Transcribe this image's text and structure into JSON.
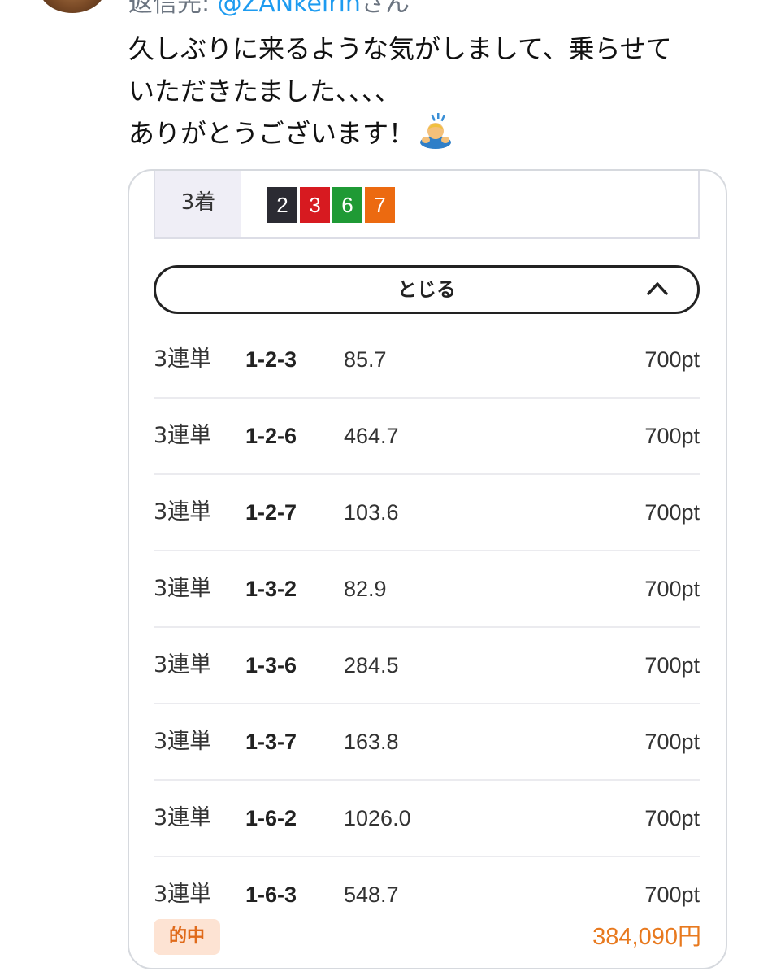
{
  "tweet": {
    "reply_prefix": "返信先: ",
    "reply_handle": "@ZANkeirin",
    "reply_suffix": "さん",
    "text_lines": [
      "久しぶりに来るような気がしまして、乗らせて",
      "いただきたました、、、、",
      "ありがとうございます！"
    ],
    "emoji": "man-bowing-emoji"
  },
  "card": {
    "place_label": "3着",
    "bike_numbers": [
      {
        "num": "2",
        "color": "#2b2b33"
      },
      {
        "num": "3",
        "color": "#d71a20"
      },
      {
        "num": "6",
        "color": "#1f9a35"
      },
      {
        "num": "7",
        "color": "#ec6a10"
      }
    ],
    "toggle_label": "とじる",
    "toggle_icon": "chevron-up-icon",
    "bets": [
      {
        "type": "3連単",
        "combo": "1-2-3",
        "odds": "85.7",
        "amount": "700pt"
      },
      {
        "type": "3連単",
        "combo": "1-2-6",
        "odds": "464.7",
        "amount": "700pt"
      },
      {
        "type": "3連単",
        "combo": "1-2-7",
        "odds": "103.6",
        "amount": "700pt"
      },
      {
        "type": "3連単",
        "combo": "1-3-2",
        "odds": "82.9",
        "amount": "700pt"
      },
      {
        "type": "3連単",
        "combo": "1-3-6",
        "odds": "284.5",
        "amount": "700pt"
      },
      {
        "type": "3連単",
        "combo": "1-3-7",
        "odds": "163.8",
        "amount": "700pt"
      },
      {
        "type": "3連単",
        "combo": "1-6-2",
        "odds": "1026.0",
        "amount": "700pt"
      },
      {
        "type": "3連単",
        "combo": "1-6-3",
        "odds": "548.7",
        "amount": "700pt"
      }
    ],
    "hit_label": "的中",
    "payout": "384,090円",
    "colors": {
      "payout": "#e8791e",
      "hit_badge_bg": "#fde3d3",
      "reply_handle": "#1d9bf0"
    }
  }
}
